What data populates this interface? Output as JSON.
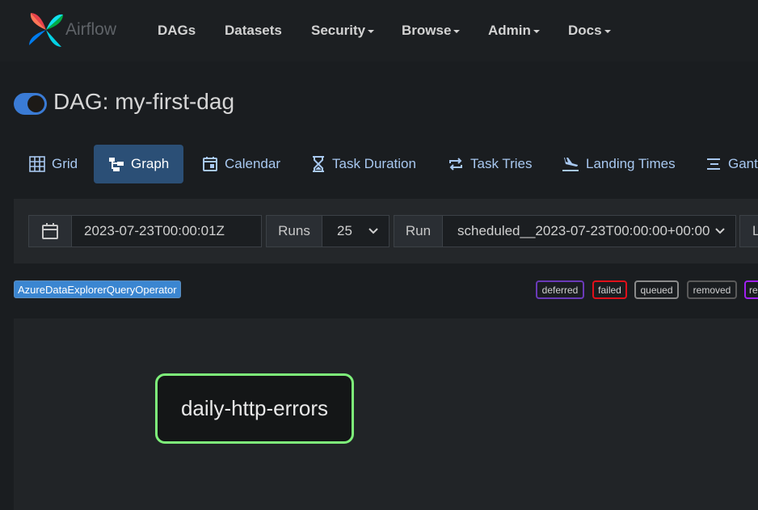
{
  "navbar": {
    "brand": "Airflow",
    "items": [
      {
        "label": "DAGs",
        "dropdown": false
      },
      {
        "label": "Datasets",
        "dropdown": false
      },
      {
        "label": "Security",
        "dropdown": true
      },
      {
        "label": "Browse",
        "dropdown": true
      },
      {
        "label": "Admin",
        "dropdown": true
      },
      {
        "label": "Docs",
        "dropdown": true
      }
    ]
  },
  "dag": {
    "title": "DAG: my-first-dag",
    "paused_toggle_on": true
  },
  "tabs": [
    {
      "label": "Grid",
      "icon": "grid-icon",
      "active": false
    },
    {
      "label": "Graph",
      "icon": "graph-icon",
      "active": true
    },
    {
      "label": "Calendar",
      "icon": "calendar-icon",
      "active": false
    },
    {
      "label": "Task Duration",
      "icon": "hourglass-icon",
      "active": false
    },
    {
      "label": "Task Tries",
      "icon": "repeat-icon",
      "active": false
    },
    {
      "label": "Landing Times",
      "icon": "plane-landing-icon",
      "active": false
    },
    {
      "label": "Gantt",
      "icon": "gantt-icon",
      "active": false
    }
  ],
  "filters": {
    "base_date": "2023-07-23T00:00:01Z",
    "runs_label": "Runs",
    "runs_value": "25",
    "run_label": "Run",
    "run_value": "scheduled__2023-07-23T00:00:00+00:00",
    "layout_label": "L"
  },
  "legend": {
    "operators": [
      "AzureDataExplorerQueryOperator"
    ],
    "states": [
      {
        "label": "deferred",
        "color": "#6a3ab8"
      },
      {
        "label": "failed",
        "color": "#e0101a"
      },
      {
        "label": "queued",
        "color": "#8a8a8a"
      },
      {
        "label": "removed",
        "color": "#5a5a5a"
      },
      {
        "label": "re",
        "color": "#a020f0"
      }
    ]
  },
  "graph": {
    "nodes": [
      {
        "label": "daily-http-errors",
        "state_color": "#7ef07a"
      }
    ]
  },
  "colors": {
    "accent": "#3a7bd5",
    "tab_active": "#2b4f76",
    "tab_text": "#a8c8f0",
    "success_border": "#7ef07a"
  }
}
